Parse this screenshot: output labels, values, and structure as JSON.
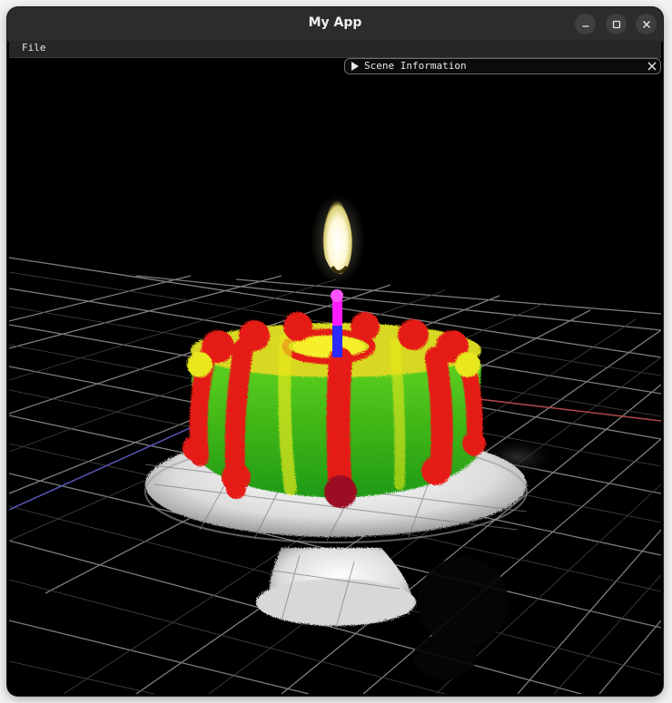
{
  "window": {
    "title": "My App",
    "controls": [
      "minimize-icon",
      "maximize-icon",
      "close-icon"
    ]
  },
  "menubar": {
    "items": [
      {
        "label": "File"
      }
    ]
  },
  "scene_panel": {
    "label": "Scene Information",
    "state": "collapsed",
    "icons": [
      "triangle-right-icon",
      "close-icon"
    ]
  },
  "viewport": {
    "description_icons": [
      "ground-grid",
      "x-axis-line",
      "z-axis-line",
      "birthday-cake-point-cloud",
      "candle",
      "candle-flame",
      "smoke"
    ],
    "colors": {
      "background": "#000000",
      "grid": "#9a9a9a",
      "x_axis": "#b04848",
      "z_axis": "#5858b8",
      "cake_green": "#2fb81a",
      "cake_red": "#e51a14",
      "cake_yellow": "#e8e81c",
      "candle": "#ff1cff",
      "flame": "#ffffe6",
      "plate": "#eaeaea"
    }
  }
}
